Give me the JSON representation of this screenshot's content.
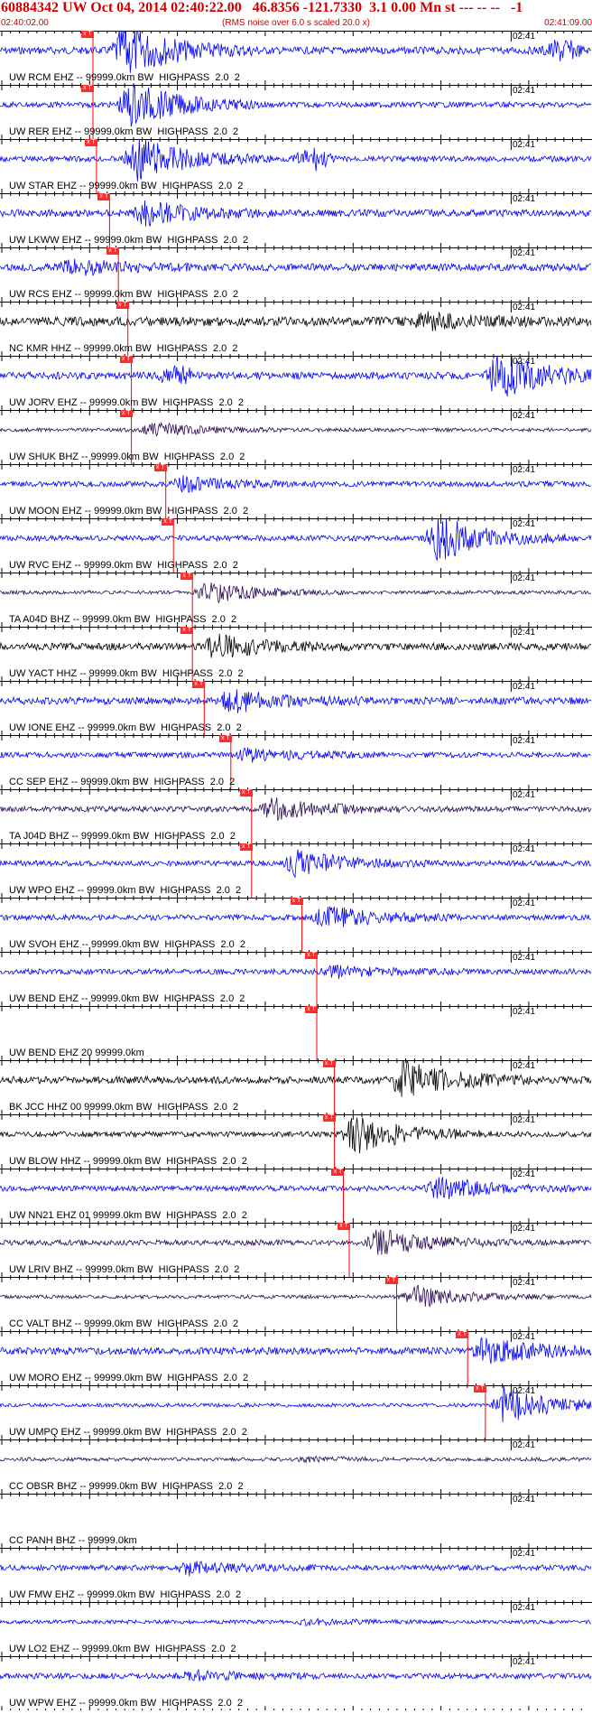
{
  "header": {
    "title": "60884342 UW Oct 04, 2014 02:40:22.00   46.8356 -121.7330  3.1 0.00 Mn st --- -- --   -1",
    "start_time": "02:40:02.00",
    "rms_note": "(RMS noise over 6.0 s scaled 20.0 x)",
    "end_time": "02:41:09.00"
  },
  "time_axis": {
    "minute_label": "02:41"
  },
  "pick_label": "x T 4",
  "colors": {
    "header_text": "#d00000",
    "pick_line": "#ff0000",
    "pick_box": "#ff2a2a",
    "blue": "#0000ff",
    "black": "#000000",
    "purple": "#2a0a55"
  },
  "stations": [
    {
      "label": "UW RCM EHZ -- 99999.0km BW  HIGHPASS  2.0  2",
      "color": "#0000ff",
      "pick": 0.157,
      "event": 0.19,
      "event_amp": 28,
      "noise": 4,
      "second": 0.95,
      "second_amp": 12
    },
    {
      "label": "UW RER EHZ -- 99999.0km BW  HIGHPASS  2.0  2",
      "color": "#0000ff",
      "pick": 0.157,
      "event": 0.2,
      "event_amp": 24,
      "noise": 3
    },
    {
      "label": "UW STAR EHZ -- 99999.0km BW  HIGHPASS  2.0  2",
      "color": "#0000ff",
      "pick": 0.163,
      "event": 0.21,
      "event_amp": 24,
      "noise": 3,
      "second": 0.53,
      "second_amp": 12
    },
    {
      "label": "UW LKWW EHZ -- 99999.0km BW  HIGHPASS  2.0  2",
      "color": "#0000ff",
      "pick": 0.185,
      "event": 0.225,
      "event_amp": 12,
      "noise": 4
    },
    {
      "label": "UW RCS EHZ -- 99999.0km BW  HIGHPASS  2.0  2",
      "color": "#0000ff",
      "pick": 0.2,
      "event": 0.1,
      "event_amp": 8,
      "noise": 4
    },
    {
      "label": "NC KMR HHZ -- 99999.0km BW  HIGHPASS  2.0  2",
      "color": "#000000",
      "pick": 0.216,
      "event": 0.7,
      "event_amp": 8,
      "noise": 5
    },
    {
      "label": "UW JORV EHZ -- 99999.0km BW  HIGHPASS  2.0  2",
      "color": "#0000ff",
      "pick": 0.222,
      "event": 0.82,
      "event_amp": 24,
      "noise": 4,
      "second": 0.3,
      "second_amp": 10
    },
    {
      "label": "UW SHUK BHZ -- 99999.0km BW  HIGHPASS  2.0  2",
      "color": "#2a0a55",
      "pick": 0.222,
      "event": 0.24,
      "event_amp": 7,
      "noise": 2
    },
    {
      "label": "UW MOON EHZ -- 99999.0km BW  HIGHPASS  2.0  2",
      "color": "#0000ff",
      "pick": 0.28,
      "event": 0.29,
      "event_amp": 7,
      "noise": 3
    },
    {
      "label": "UW RVC EHZ -- 99999.0km BW  HIGHPASS  2.0  2",
      "color": "#0000ff",
      "pick": 0.293,
      "event": 0.72,
      "event_amp": 24,
      "noise": 3
    },
    {
      "label": "TA A04D BHZ -- 99999.0km BW  HIGHPASS  2.0  2",
      "color": "#2a0a55",
      "pick": 0.325,
      "event": 0.33,
      "event_amp": 12,
      "noise": 2
    },
    {
      "label": "UW YACT HHZ -- 99999.0km BW  HIGHPASS  2.0  2",
      "color": "#000000",
      "pick": 0.325,
      "event": 0.34,
      "event_amp": 12,
      "noise": 4
    },
    {
      "label": "UW IONE EHZ -- 99999.0km BW  HIGHPASS  2.0  2",
      "color": "#0000ff",
      "pick": 0.345,
      "event": 0.37,
      "event_amp": 12,
      "noise": 4
    },
    {
      "label": "CC SEP EHZ -- 99999.0km BW  HIGHPASS  2.0  2",
      "color": "#0000ff",
      "pick": 0.39,
      "event": 0.4,
      "event_amp": 6,
      "noise": 3
    },
    {
      "label": "TA J04D BHZ -- 99999.0km BW  HIGHPASS  2.0  2",
      "color": "#2a0a55",
      "pick": 0.425,
      "event": 0.44,
      "event_amp": 12,
      "noise": 3
    },
    {
      "label": "UW WPO EHZ -- 99999.0km BW  HIGHPASS  2.0  2",
      "color": "#0000ff",
      "pick": 0.425,
      "event": 0.48,
      "event_amp": 14,
      "noise": 3
    },
    {
      "label": "UW SVOH EHZ -- 99999.0km BW  HIGHPASS  2.0  2",
      "color": "#0000ff",
      "pick": 0.51,
      "event": 0.53,
      "event_amp": 12,
      "noise": 3
    },
    {
      "label": "UW BEND EHZ -- 99999.0km BW  HIGHPASS  2.0  2",
      "color": "#0000ff",
      "pick": 0.535,
      "event": 0.54,
      "event_amp": 6,
      "noise": 3
    },
    {
      "label": "UW BEND EHZ 20 99999.0km",
      "color": "#0000ff",
      "pick": 0.535,
      "event": 0.54,
      "event_amp": 0,
      "noise": 0
    },
    {
      "label": "BK JCC HHZ 00 99999.0km BW  HIGHPASS  2.0  2",
      "color": "#000000",
      "pick": 0.565,
      "event": 0.66,
      "event_amp": 20,
      "noise": 4
    },
    {
      "label": "UW BLOW HHZ -- 99999.0km BW  HIGHPASS  2.0  2",
      "color": "#000000",
      "pick": 0.565,
      "event": 0.58,
      "event_amp": 20,
      "noise": 3
    },
    {
      "label": "UW NN21 EHZ 01 99999.0km BW  HIGHPASS  2.0  2",
      "color": "#0000ff",
      "pick": 0.58,
      "event": 0.72,
      "event_amp": 12,
      "noise": 3
    },
    {
      "label": "UW LRIV BHZ -- 99999.0km BW  HIGHPASS  2.0  2",
      "color": "#2a0a55",
      "pick": 0.59,
      "event": 0.62,
      "event_amp": 14,
      "noise": 3
    },
    {
      "label": "CC VALT BHZ -- 99999.0km BW  HIGHPASS  2.0  2",
      "color": "#2a0a55",
      "pick": 0.67,
      "event": 0.68,
      "event_amp": 12,
      "noise": 2
    },
    {
      "label": "UW MORO EHZ -- 99999.0km BW  HIGHPASS  2.0  2",
      "color": "#0000ff",
      "pick": 0.79,
      "event": 0.8,
      "event_amp": 14,
      "noise": 4
    },
    {
      "label": "UW UMPQ EHZ -- 99999.0km BW  HIGHPASS  2.0  2",
      "color": "#0000ff",
      "pick": 0.82,
      "event": 0.83,
      "event_amp": 20,
      "noise": 2
    },
    {
      "label": "CC OBSR BHZ -- 99999.0km BW  HIGHPASS  2.0  2",
      "color": "#2a0a55",
      "pick": -1,
      "event": 0.5,
      "event_amp": 2,
      "noise": 2
    },
    {
      "label": "CC PANH BHZ -- 99999.0km",
      "color": "#2a0a55",
      "pick": -1,
      "event": 0.5,
      "event_amp": 0,
      "noise": 0
    },
    {
      "label": "UW FMW EHZ -- 99999.0km BW  HIGHPASS  2.0  2",
      "color": "#0000ff",
      "pick": -1,
      "event": 0.3,
      "event_amp": 7,
      "noise": 3
    },
    {
      "label": "UW LO2 EHZ -- 99999.0km BW  HIGHPASS  2.0  2",
      "color": "#0000ff",
      "pick": -1,
      "event": 0.5,
      "event_amp": 3,
      "noise": 2
    },
    {
      "label": "UW WPW EHZ -- 99999.0km BW  HIGHPASS  2.0  2",
      "color": "#0000ff",
      "pick": -1,
      "event": 0.3,
      "event_amp": 5,
      "noise": 3
    }
  ]
}
